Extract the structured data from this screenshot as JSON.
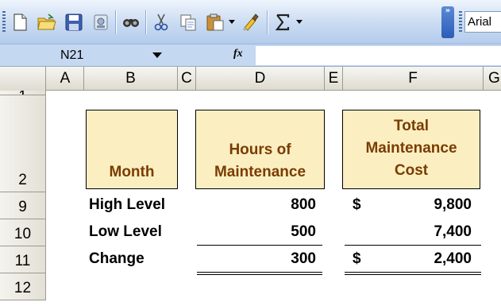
{
  "toolbar": {
    "font_name": "Arial",
    "overflow_label": "»",
    "buttons": [
      {
        "name": "new-document-icon"
      },
      {
        "name": "open-folder-icon"
      },
      {
        "name": "save-icon"
      },
      {
        "name": "permission-icon"
      },
      {
        "name": "research-icon"
      },
      {
        "name": "cut-icon"
      },
      {
        "name": "copy-icon"
      },
      {
        "name": "paste-icon"
      },
      {
        "name": "format-painter-icon"
      },
      {
        "name": "autosum-icon"
      }
    ]
  },
  "formula_bar": {
    "name_box": "N21",
    "fx_label": "fx",
    "formula": ""
  },
  "columns": [
    "A",
    "B",
    "C",
    "D",
    "E",
    "F",
    "G"
  ],
  "rows": [
    "1",
    "2",
    "9",
    "10",
    "11",
    "12"
  ],
  "table": {
    "headers": {
      "month": "Month",
      "hours_line1": "Hours of",
      "hours_line2": "Maintenance",
      "cost_line1": "Total",
      "cost_line2": "Maintenance",
      "cost_line3": "Cost"
    },
    "currency_symbol": "$",
    "data": [
      {
        "label": "High Level",
        "hours": "800",
        "currency": "$",
        "cost": "9,800"
      },
      {
        "label": "Low Level",
        "hours": "500",
        "currency": "",
        "cost": "7,400"
      },
      {
        "label": "Change",
        "hours": "300",
        "currency": "$",
        "cost": "2,400"
      }
    ]
  },
  "colors": {
    "header_fill": "#fbefc2",
    "header_text": "#7a3c00"
  }
}
